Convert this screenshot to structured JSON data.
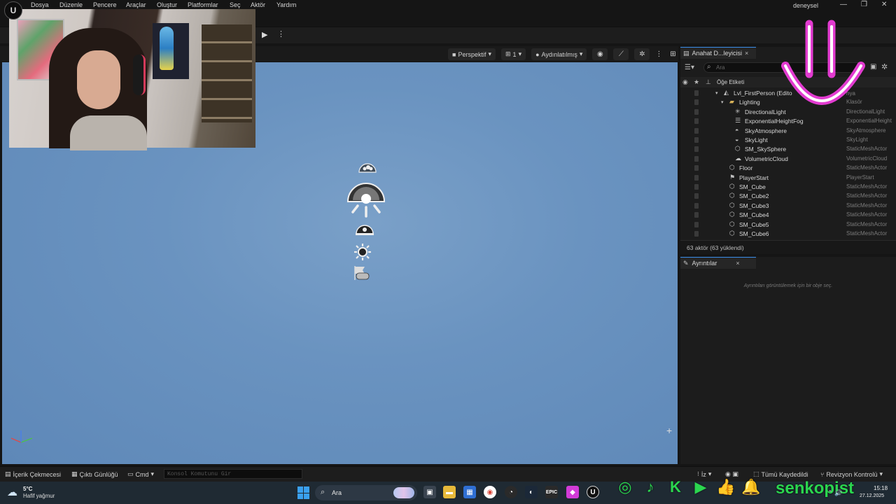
{
  "menu": {
    "items": [
      "Dosya",
      "Düzenle",
      "Pencere",
      "Araçlar",
      "Oluştur",
      "Platformlar",
      "Seç",
      "Aktör",
      "Yardım"
    ],
    "project_name": "deneysel"
  },
  "window_controls": {
    "minimize": "—",
    "restore": "❐",
    "close": "✕"
  },
  "viewport": {
    "perspective_label": "Perspektif",
    "camera_speed_label": "1",
    "lit_label": "Aydınlatılmış"
  },
  "outliner": {
    "tab_title": "Anahat D...leyicisi",
    "search_placeholder": "Ara",
    "column_label": "Öğe Etiketi",
    "column_type_hint": "nya",
    "rows": [
      {
        "name": "Lvl_FirstPerson (Edito",
        "type": "",
        "icon": "world-icon",
        "indent": 0
      },
      {
        "name": "Lighting",
        "type": "Klasör",
        "icon": "folder-icon",
        "indent": 1
      },
      {
        "name": "DirectionalLight",
        "type": "DirectionalLight",
        "icon": "directional-light-icon",
        "indent": 2
      },
      {
        "name": "ExponentialHeightFog",
        "type": "ExponentialHeight",
        "icon": "fog-icon",
        "indent": 2
      },
      {
        "name": "SkyAtmosphere",
        "type": "SkyAtmosphere",
        "icon": "atmosphere-icon",
        "indent": 2
      },
      {
        "name": "SkyLight",
        "type": "SkyLight",
        "icon": "skylight-icon",
        "indent": 2
      },
      {
        "name": "SM_SkySphere",
        "type": "StaticMeshActor",
        "icon": "static-mesh-icon",
        "indent": 2
      },
      {
        "name": "VolumetricCloud",
        "type": "VolumetricCloud",
        "icon": "cloud-icon",
        "indent": 2
      },
      {
        "name": "Floor",
        "type": "StaticMeshActor",
        "icon": "static-mesh-icon",
        "indent": 1
      },
      {
        "name": "PlayerStart",
        "type": "PlayerStart",
        "icon": "player-start-icon",
        "indent": 1
      },
      {
        "name": "SM_Cube",
        "type": "StaticMeshActor",
        "icon": "static-mesh-icon",
        "indent": 1
      },
      {
        "name": "SM_Cube2",
        "type": "StaticMeshActor",
        "icon": "static-mesh-icon",
        "indent": 1
      },
      {
        "name": "SM_Cube3",
        "type": "StaticMeshActor",
        "icon": "static-mesh-icon",
        "indent": 1
      },
      {
        "name": "SM_Cube4",
        "type": "StaticMeshActor",
        "icon": "static-mesh-icon",
        "indent": 1
      },
      {
        "name": "SM_Cube5",
        "type": "StaticMeshActor",
        "icon": "static-mesh-icon",
        "indent": 1
      },
      {
        "name": "SM_Cube6",
        "type": "StaticMeshActor",
        "icon": "static-mesh-icon",
        "indent": 1
      }
    ],
    "status": "63 aktör (63 yüklendi)"
  },
  "details": {
    "tab_title": "Ayrıntılar",
    "hint": "Ayrıntıları görüntülemek için bir obje seç."
  },
  "statusbar": {
    "content_drawer": "İçerik Çekmecesi",
    "output_log": "Çıktı Günlüğü",
    "cmd": "Cmd",
    "console_placeholder": "Konsol Komutunu Gir",
    "trace_label": "İz",
    "save_all": "Tümü Kaydedildi",
    "revision_control": "Revizyon Kontrolü"
  },
  "taskbar": {
    "weather_temp": "5°C",
    "weather_desc": "Hafif yağmur",
    "search_label": "Ara",
    "time": "15:18",
    "date": "27.12.2025"
  },
  "overlay": {
    "brand": "senkopist",
    "social_icons": [
      "instagram-icon",
      "tiktok-icon",
      "kick-icon",
      "youtube-icon",
      "thumbs-up-icon",
      "bell-icon"
    ],
    "accent_green": "#2bd64f",
    "smiley_color": "#e23bd0"
  },
  "colors": {
    "editor_bg": "#151515",
    "panel_bg": "#1c1c1c",
    "viewport_sky": "#6a93c0",
    "accent_blue": "#3a8eea"
  }
}
